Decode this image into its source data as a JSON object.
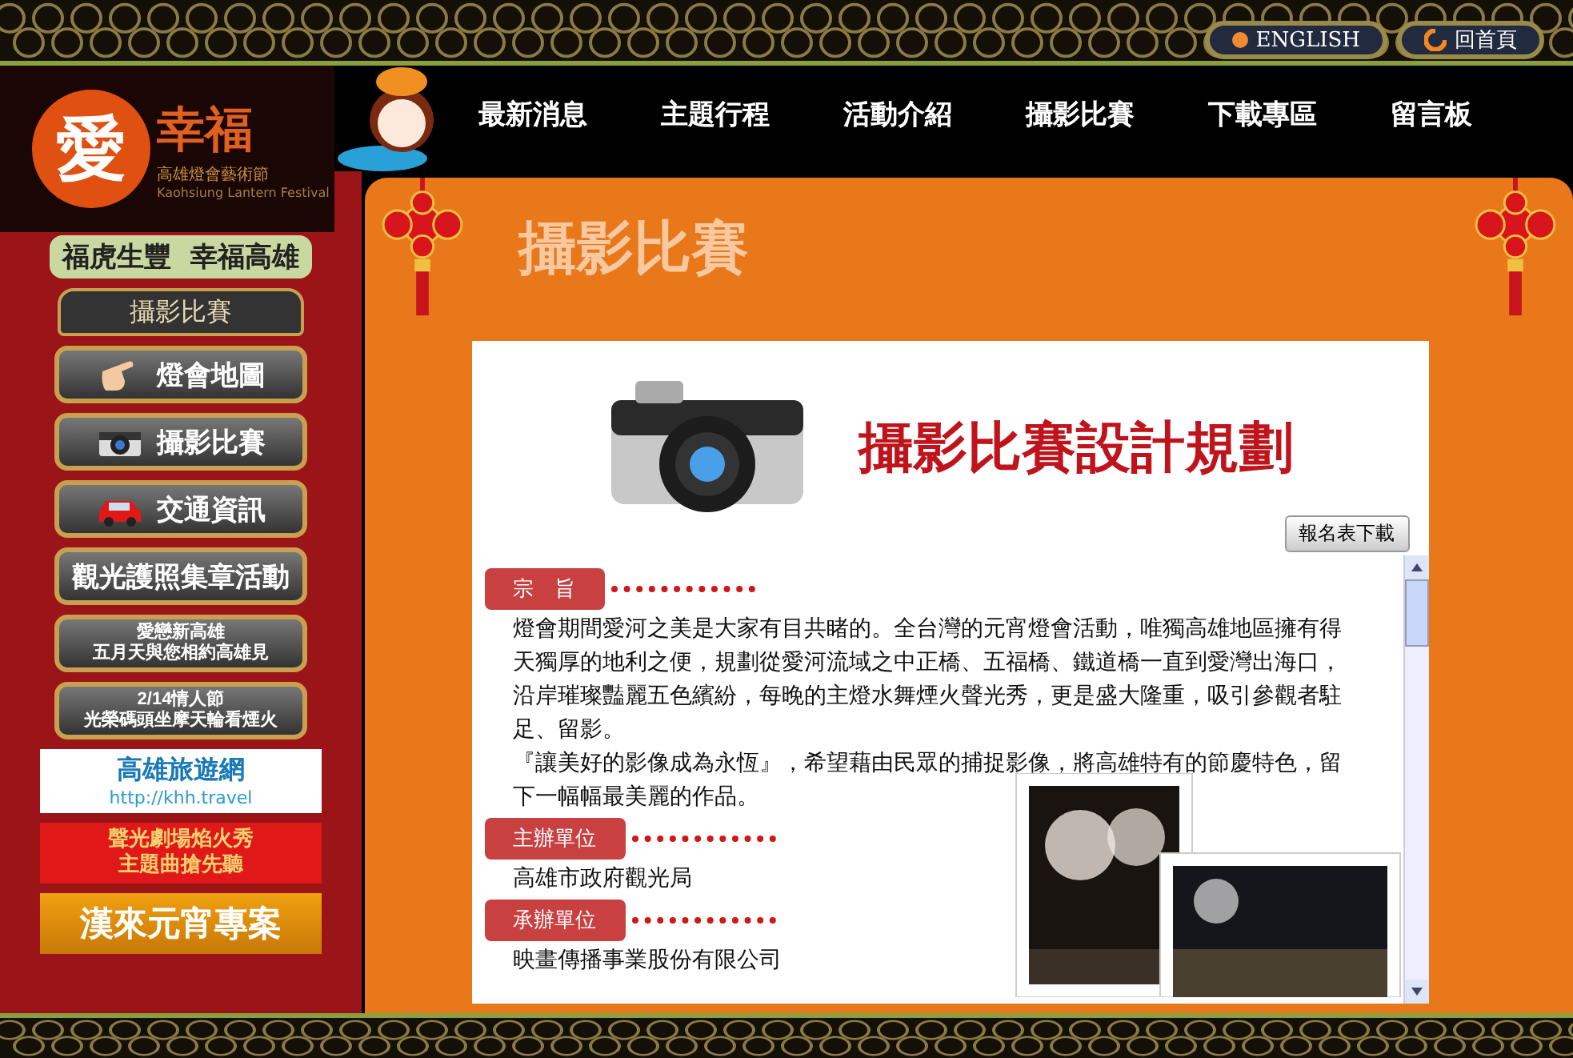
{
  "logo": {
    "mark": "愛",
    "title": "幸福",
    "subtitle": "高雄燈會藝術節",
    "english": "Kaohsiung Lantern Festival"
  },
  "top_links": [
    {
      "label": "ENGLISH",
      "kind": "dot"
    },
    {
      "label": "回首頁",
      "kind": "swirl"
    }
  ],
  "nav": [
    "最新消息",
    "主題行程",
    "活動介紹",
    "攝影比賽",
    "下載專區",
    "留言板"
  ],
  "slogan": [
    "福虎生豐",
    "幸福高雄"
  ],
  "sidebar": {
    "heading": "攝影比賽",
    "items": [
      {
        "label": "燈會地圖",
        "kind": "hand"
      },
      {
        "label": "攝影比賽",
        "kind": "camera"
      },
      {
        "label": "交通資訊",
        "kind": "car"
      },
      {
        "label": "觀光護照集章活動",
        "kind": "text"
      },
      {
        "lines": [
          "愛戀新高雄",
          "五月天與您相約高雄見"
        ],
        "kind": "small"
      },
      {
        "lines": [
          "2/14情人節",
          "光榮碼頭坐摩天輪看煙火"
        ],
        "kind": "small"
      }
    ],
    "banners": [
      {
        "kind": "travel",
        "title": "高雄旅遊網",
        "url": "http://khh.travel"
      },
      {
        "kind": "red",
        "lines": [
          "聲光劇場焰火秀",
          "主題曲搶先聽"
        ]
      },
      {
        "kind": "gold",
        "title": "漢來元宵專案"
      }
    ]
  },
  "page_title": "攝影比賽",
  "card": {
    "title": "攝影比賽設計規劃",
    "download": "報名表下載",
    "sections": [
      {
        "heading": "宗　旨",
        "paragraphs": [
          "燈會期間愛河之美是大家有目共睹的。全台灣的元宵燈會活動，唯獨高雄地區擁有得天獨厚的地利之便，規劃從愛河流域之中正橋、五福橋、鐵道橋一直到愛灣出海口，沿岸璀璨豔麗五色繽紛，每晚的主燈水舞煙火聲光秀，更是盛大隆重，吸引參觀者駐足、留影。",
          "『讓美好的影像成為永恆』，希望藉由民眾的捕捉影像，將高雄特有的節慶特色，留下一幅幅最美麗的作品。"
        ]
      },
      {
        "heading": "主辦單位",
        "paragraphs": [
          "高雄市政府觀光局"
        ]
      },
      {
        "heading": "承辦單位",
        "paragraphs": [
          "映畫傳播事業股份有限公司"
        ]
      }
    ]
  }
}
